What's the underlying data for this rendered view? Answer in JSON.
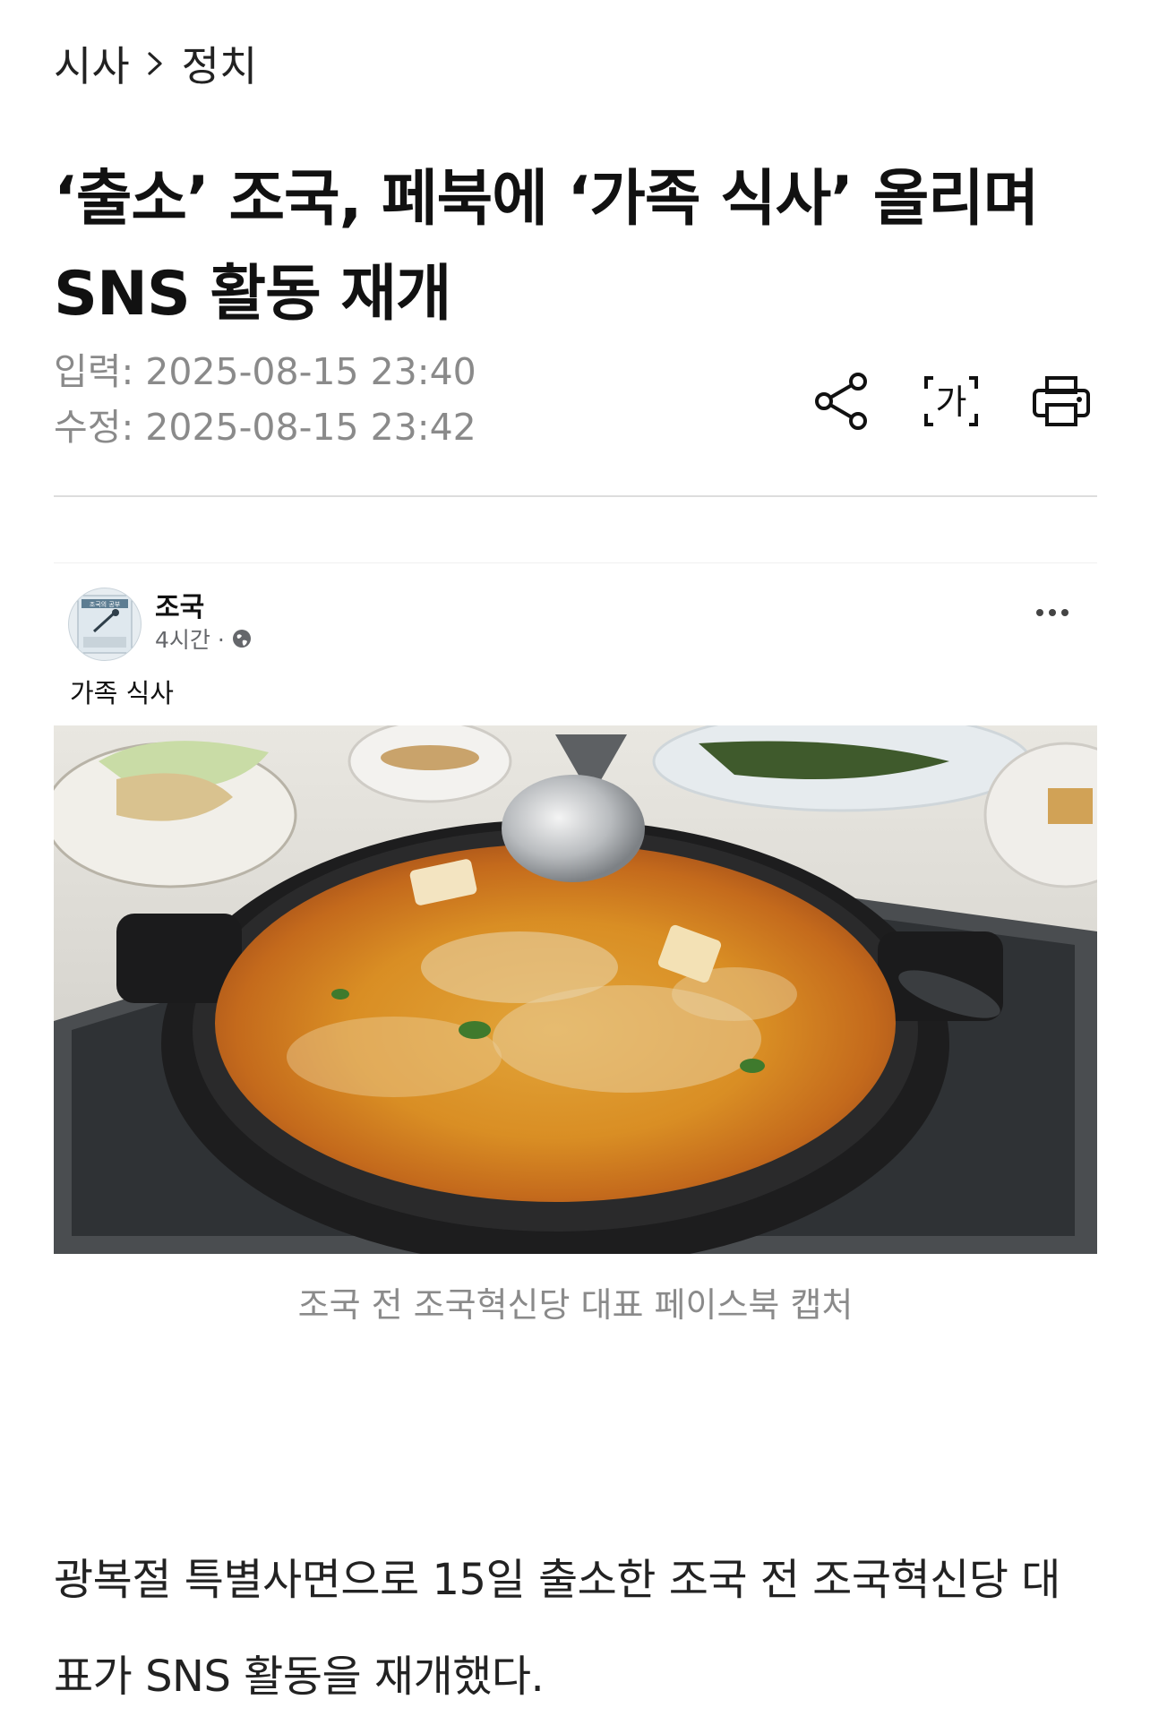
{
  "breadcrumb": {
    "section": "시사",
    "subsection": "정치"
  },
  "headline": "‘출소’ 조국, 페북에 ‘가족 식사’ 올리며 SNS 활동 재개",
  "meta": {
    "input_line": "입력: 2025-08-15 23:40",
    "modified_line": "수정: 2025-08-15 23:42"
  },
  "tools": {
    "share_icon": "share-icon",
    "font_size_label": "가",
    "print_icon": "print-icon"
  },
  "facebook_post": {
    "author": "조국",
    "time": "4시간 ·",
    "text": "가족 식사",
    "avatar_text": "조국의 공부"
  },
  "photo": {
    "description_icon": "photo-image"
  },
  "caption": "조국 전 조국혁신당 대표 페이스북 캡처",
  "body": {
    "paragraph": "광복절 특별사면으로 15일 출소한 조국 전 조국혁신당 대표가 SNS 활동을 재개했다."
  },
  "colors": {
    "text": "#111111",
    "meta": "#8a8a8a",
    "divider": "#dddddd"
  }
}
